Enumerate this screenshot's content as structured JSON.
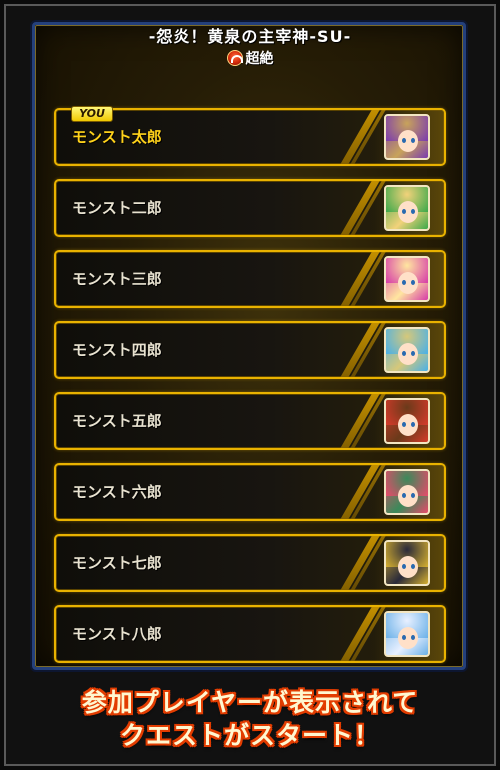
{
  "header": {
    "title": "-怨炎！黄泉の主宰神-SU-",
    "difficulty_label": "超絶",
    "difficulty_icon": "skull-icon"
  },
  "you_badge": "YOU",
  "players": [
    {
      "name": "モンスト太郎",
      "is_you": true,
      "avatar_colors": [
        "#c8a35a",
        "#7a3ab0"
      ]
    },
    {
      "name": "モンスト二郎",
      "is_you": false,
      "avatar_colors": [
        "#f2d27a",
        "#3aa84a"
      ]
    },
    {
      "name": "モンスト三郎",
      "is_you": false,
      "avatar_colors": [
        "#ffe6a0",
        "#d63aa8"
      ]
    },
    {
      "name": "モンスト四郎",
      "is_you": false,
      "avatar_colors": [
        "#d6c87a",
        "#48b0e8"
      ]
    },
    {
      "name": "モンスト五郎",
      "is_you": false,
      "avatar_colors": [
        "#6a3a1a",
        "#d63a2a"
      ]
    },
    {
      "name": "モンスト六郎",
      "is_you": false,
      "avatar_colors": [
        "#3a8a5a",
        "#e84a6a"
      ]
    },
    {
      "name": "モンスト七郎",
      "is_you": false,
      "avatar_colors": [
        "#2a2a3a",
        "#d6b030"
      ]
    },
    {
      "name": "モンスト八郎",
      "is_you": false,
      "avatar_colors": [
        "#e8f0ff",
        "#6ab0e8"
      ]
    }
  ],
  "caption": {
    "line1": "参加プレイヤーが表示されて",
    "line2": "クエストがスタート！"
  },
  "colors": {
    "row_border": "#e9b200",
    "panel_border": "#24407c",
    "you_name": "#ffd21a",
    "caption_outline": "#e23c00"
  }
}
